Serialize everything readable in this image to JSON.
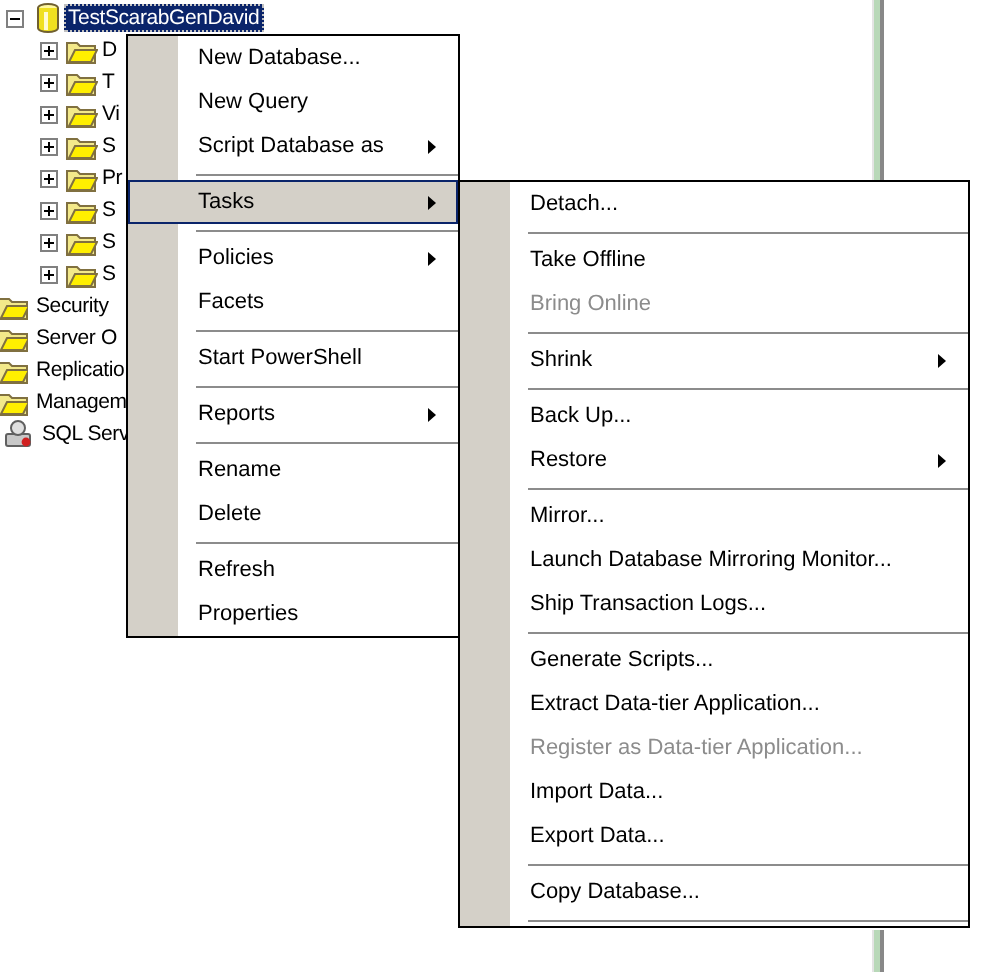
{
  "tree": [
    {
      "label": "TestScarabGenDavid",
      "kind": "database",
      "expanded": true,
      "selected": true,
      "children": [
        {
          "label": "D",
          "kind": "folder",
          "expanded": false,
          "selected": false
        },
        {
          "label": "T",
          "kind": "folder",
          "expanded": false,
          "selected": false
        },
        {
          "label": "Vi",
          "kind": "folder",
          "expanded": false,
          "selected": false
        },
        {
          "label": "S",
          "kind": "folder",
          "expanded": false,
          "selected": false
        },
        {
          "label": "Pr",
          "kind": "folder",
          "expanded": false,
          "selected": false
        },
        {
          "label": "S",
          "kind": "folder",
          "expanded": false,
          "selected": false
        },
        {
          "label": "S",
          "kind": "folder",
          "expanded": false,
          "selected": false
        },
        {
          "label": "S",
          "kind": "folder",
          "expanded": false,
          "selected": false
        }
      ]
    },
    {
      "label": "Security",
      "kind": "top-folder",
      "selected": false
    },
    {
      "label": "Server O",
      "kind": "top-folder",
      "selected": false
    },
    {
      "label": "Replicatio",
      "kind": "top-folder",
      "selected": false
    },
    {
      "label": "Managem",
      "kind": "top-folder",
      "selected": false
    },
    {
      "label": "SQL Serv",
      "kind": "agent",
      "selected": false
    }
  ],
  "context_menu": [
    {
      "kind": "item",
      "label": "New Database...",
      "submenu": false,
      "disabled": false,
      "selected": false
    },
    {
      "kind": "item",
      "label": "New Query",
      "submenu": false,
      "disabled": false,
      "selected": false
    },
    {
      "kind": "item",
      "label": "Script Database as",
      "submenu": true,
      "disabled": false,
      "selected": false
    },
    {
      "kind": "separator"
    },
    {
      "kind": "item",
      "label": "Tasks",
      "submenu": true,
      "disabled": false,
      "selected": true
    },
    {
      "kind": "separator"
    },
    {
      "kind": "item",
      "label": "Policies",
      "submenu": true,
      "disabled": false,
      "selected": false
    },
    {
      "kind": "item",
      "label": "Facets",
      "submenu": false,
      "disabled": false,
      "selected": false
    },
    {
      "kind": "separator"
    },
    {
      "kind": "item",
      "label": "Start PowerShell",
      "submenu": false,
      "disabled": false,
      "selected": false
    },
    {
      "kind": "separator"
    },
    {
      "kind": "item",
      "label": "Reports",
      "submenu": true,
      "disabled": false,
      "selected": false
    },
    {
      "kind": "separator"
    },
    {
      "kind": "item",
      "label": "Rename",
      "submenu": false,
      "disabled": false,
      "selected": false
    },
    {
      "kind": "item",
      "label": "Delete",
      "submenu": false,
      "disabled": false,
      "selected": false
    },
    {
      "kind": "separator"
    },
    {
      "kind": "item",
      "label": "Refresh",
      "submenu": false,
      "disabled": false,
      "selected": false
    },
    {
      "kind": "item",
      "label": "Properties",
      "submenu": false,
      "disabled": false,
      "selected": false
    }
  ],
  "tasks_submenu": [
    {
      "kind": "item",
      "label": "Detach...",
      "submenu": false,
      "disabled": false,
      "selected": false
    },
    {
      "kind": "separator"
    },
    {
      "kind": "item",
      "label": "Take Offline",
      "submenu": false,
      "disabled": false,
      "selected": false
    },
    {
      "kind": "item",
      "label": "Bring Online",
      "submenu": false,
      "disabled": true,
      "selected": false
    },
    {
      "kind": "separator"
    },
    {
      "kind": "item",
      "label": "Shrink",
      "submenu": true,
      "disabled": false,
      "selected": false
    },
    {
      "kind": "separator"
    },
    {
      "kind": "item",
      "label": "Back Up...",
      "submenu": false,
      "disabled": false,
      "selected": false
    },
    {
      "kind": "item",
      "label": "Restore",
      "submenu": true,
      "disabled": false,
      "selected": false
    },
    {
      "kind": "separator"
    },
    {
      "kind": "item",
      "label": "Mirror...",
      "submenu": false,
      "disabled": false,
      "selected": false
    },
    {
      "kind": "item",
      "label": "Launch Database Mirroring Monitor...",
      "submenu": false,
      "disabled": false,
      "selected": false
    },
    {
      "kind": "item",
      "label": "Ship Transaction Logs...",
      "submenu": false,
      "disabled": false,
      "selected": false
    },
    {
      "kind": "separator"
    },
    {
      "kind": "item",
      "label": "Generate Scripts...",
      "submenu": false,
      "disabled": false,
      "selected": false
    },
    {
      "kind": "item",
      "label": "Extract Data-tier Application...",
      "submenu": false,
      "disabled": false,
      "selected": false
    },
    {
      "kind": "item",
      "label": "Register as Data-tier Application...",
      "submenu": false,
      "disabled": true,
      "selected": false
    },
    {
      "kind": "item",
      "label": "Import Data...",
      "submenu": false,
      "disabled": false,
      "selected": false
    },
    {
      "kind": "item",
      "label": "Export Data...",
      "submenu": false,
      "disabled": false,
      "selected": false
    },
    {
      "kind": "separator"
    },
    {
      "kind": "item",
      "label": "Copy Database...",
      "submenu": false,
      "disabled": false,
      "selected": false
    },
    {
      "kind": "separator"
    }
  ]
}
